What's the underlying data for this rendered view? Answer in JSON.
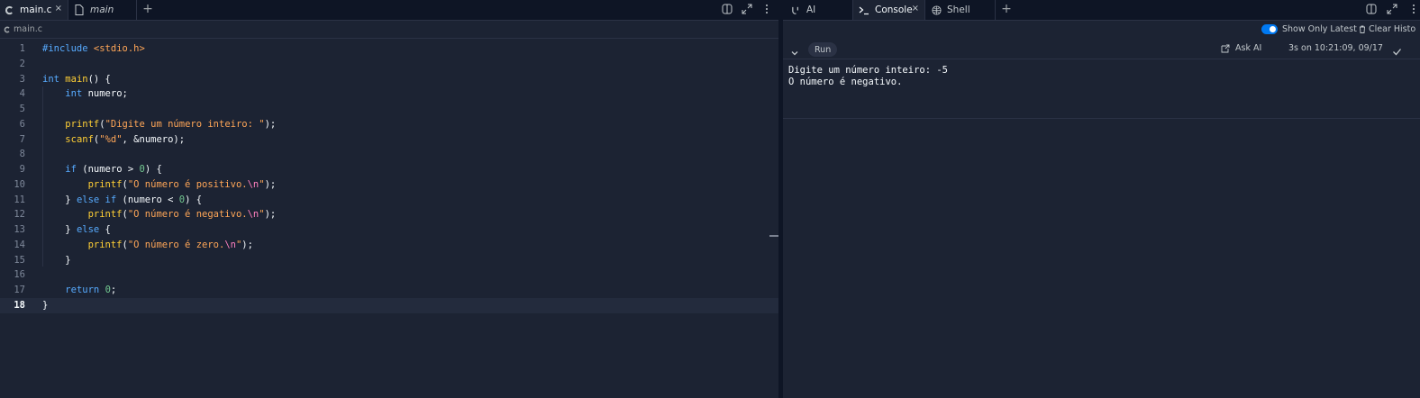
{
  "editor": {
    "tabs": [
      {
        "label": "main.c",
        "icon": "c-language-icon",
        "active": true
      },
      {
        "label": "main",
        "icon": "file-icon",
        "active": false
      }
    ],
    "close_glyph": "×",
    "add_tab_glyph": "+",
    "breadcrumb": "main.c",
    "current_line": 18,
    "lines": [
      {
        "n": "1",
        "tokens": [
          [
            "pp",
            "#include "
          ],
          [
            "hdr",
            "<stdio.h>"
          ]
        ]
      },
      {
        "n": "2",
        "tokens": []
      },
      {
        "n": "3",
        "tokens": [
          [
            "kw",
            "int "
          ],
          [
            "fn",
            "main"
          ],
          [
            "",
            "() {"
          ]
        ]
      },
      {
        "n": "4",
        "tokens": [
          [
            "",
            "    "
          ],
          [
            "kw",
            "int "
          ],
          [
            "",
            "numero;"
          ]
        ]
      },
      {
        "n": "5",
        "tokens": []
      },
      {
        "n": "6",
        "tokens": [
          [
            "",
            "    "
          ],
          [
            "fn",
            "printf"
          ],
          [
            "",
            "("
          ],
          [
            "str",
            "\"Digite um número inteiro: \""
          ],
          [
            "",
            ");"
          ]
        ]
      },
      {
        "n": "7",
        "tokens": [
          [
            "",
            "    "
          ],
          [
            "fn",
            "scanf"
          ],
          [
            "",
            "("
          ],
          [
            "str",
            "\"%d\""
          ],
          [
            "",
            ", &numero);"
          ]
        ]
      },
      {
        "n": "8",
        "tokens": []
      },
      {
        "n": "9",
        "tokens": [
          [
            "",
            "    "
          ],
          [
            "kw",
            "if "
          ],
          [
            "",
            "(numero > "
          ],
          [
            "num",
            "0"
          ],
          [
            "",
            ") {"
          ]
        ]
      },
      {
        "n": "10",
        "tokens": [
          [
            "",
            "        "
          ],
          [
            "fn",
            "printf"
          ],
          [
            "",
            "("
          ],
          [
            "str",
            "\"O número é positivo."
          ],
          [
            "esc",
            "\\n"
          ],
          [
            "str",
            "\""
          ],
          [
            "",
            ");"
          ]
        ]
      },
      {
        "n": "11",
        "tokens": [
          [
            "",
            "    } "
          ],
          [
            "kw",
            "else if "
          ],
          [
            "",
            "(numero < "
          ],
          [
            "num",
            "0"
          ],
          [
            "",
            ") {"
          ]
        ]
      },
      {
        "n": "12",
        "tokens": [
          [
            "",
            "        "
          ],
          [
            "fn",
            "printf"
          ],
          [
            "",
            "("
          ],
          [
            "str",
            "\"O número é negativo."
          ],
          [
            "esc",
            "\\n"
          ],
          [
            "str",
            "\""
          ],
          [
            "",
            ");"
          ]
        ]
      },
      {
        "n": "13",
        "tokens": [
          [
            "",
            "    } "
          ],
          [
            "kw",
            "else "
          ],
          [
            "",
            "{"
          ]
        ]
      },
      {
        "n": "14",
        "tokens": [
          [
            "",
            "        "
          ],
          [
            "fn",
            "printf"
          ],
          [
            "",
            "("
          ],
          [
            "str",
            "\"O número é zero."
          ],
          [
            "esc",
            "\\n"
          ],
          [
            "str",
            "\""
          ],
          [
            "",
            ");"
          ]
        ]
      },
      {
        "n": "15",
        "tokens": [
          [
            "",
            "    }"
          ]
        ]
      },
      {
        "n": "16",
        "tokens": []
      },
      {
        "n": "17",
        "tokens": [
          [
            "",
            "    "
          ],
          [
            "kw",
            "return "
          ],
          [
            "num",
            "0"
          ],
          [
            "",
            ";"
          ]
        ]
      },
      {
        "n": "18",
        "tokens": [
          [
            "",
            "}"
          ]
        ]
      }
    ]
  },
  "console": {
    "tabs": [
      {
        "label": "AI",
        "icon": "ai-icon",
        "active": false
      },
      {
        "label": "Console",
        "icon": "console-icon",
        "active": true
      },
      {
        "label": "Shell",
        "icon": "shell-icon",
        "active": false
      }
    ],
    "show_only_latest_label": "Show Only Latest",
    "clear_history_label": "Clear Histo",
    "run_label": "Run",
    "ask_ai_label": "Ask AI",
    "run_info": "3s on 10:21:09, 09/17",
    "output": "Digite um número inteiro: -5\nO número é negativo."
  },
  "colors": {
    "background": "#1c2333",
    "tabbar": "#0e1525",
    "accent": "#0079f2"
  }
}
